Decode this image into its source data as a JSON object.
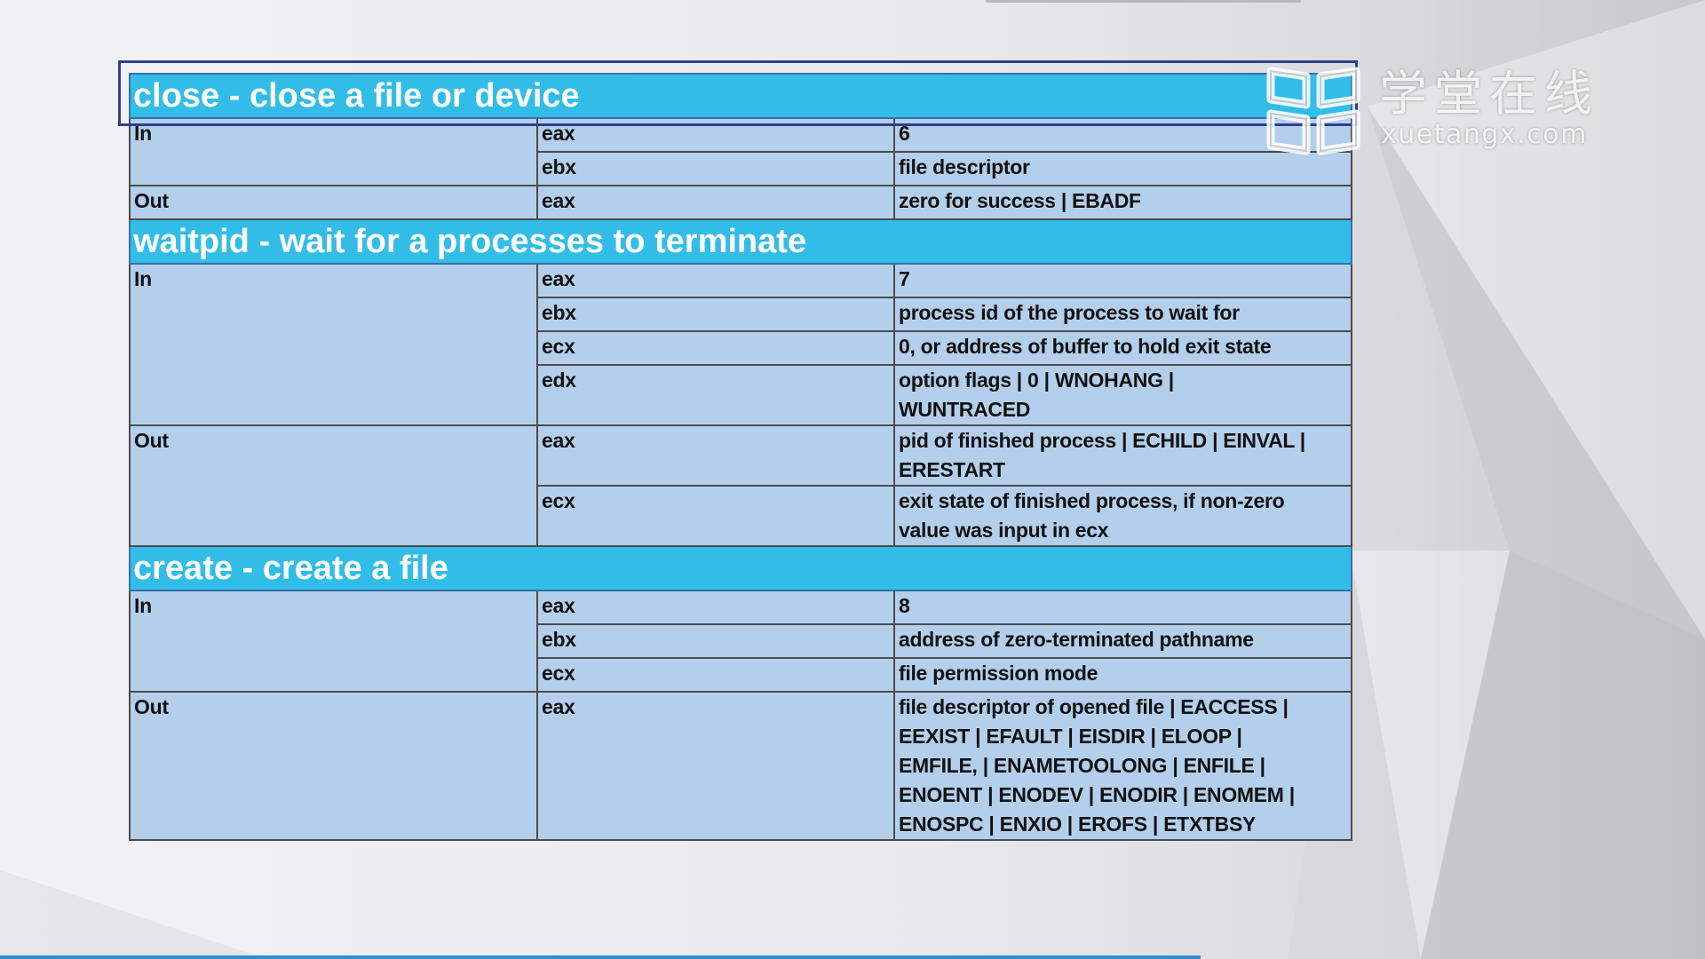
{
  "watermark": {
    "brand_cn": "学堂在线",
    "brand_url": "xuetangx.com"
  },
  "sections": [
    {
      "title": "close - close a file or device",
      "groups": [
        {
          "dir": "In",
          "rows": [
            {
              "reg": "eax",
              "value": [
                "6"
              ]
            },
            {
              "reg": "ebx",
              "value": [
                "file descriptor"
              ]
            }
          ]
        },
        {
          "dir": "Out",
          "rows": [
            {
              "reg": "eax",
              "value": [
                "zero for success | EBADF"
              ]
            }
          ]
        }
      ]
    },
    {
      "title": "waitpid - wait for a processes to terminate",
      "groups": [
        {
          "dir": "In",
          "rows": [
            {
              "reg": "eax",
              "value": [
                "7"
              ]
            },
            {
              "reg": "ebx",
              "value": [
                "process id of the process to wait for"
              ]
            },
            {
              "reg": "ecx",
              "value": [
                "0, or address of buffer to hold exit state"
              ]
            },
            {
              "reg": "edx",
              "value": [
                "option flags | 0 | WNOHANG |",
                "WUNTRACED"
              ]
            }
          ]
        },
        {
          "dir": "Out",
          "rows": [
            {
              "reg": "eax",
              "value": [
                "pid of finished process | ECHILD | EINVAL |",
                "ERESTART"
              ]
            },
            {
              "reg": "ecx",
              "value": [
                "exit state of finished process, if non-zero",
                "value was input in ecx"
              ]
            }
          ]
        }
      ]
    },
    {
      "title": "create - create a file",
      "groups": [
        {
          "dir": "In",
          "rows": [
            {
              "reg": "eax",
              "value": [
                "8"
              ]
            },
            {
              "reg": "ebx",
              "value": [
                "address of zero-terminated pathname"
              ]
            },
            {
              "reg": "ecx",
              "value": [
                "file permission mode"
              ]
            }
          ]
        },
        {
          "dir": "Out",
          "rows": [
            {
              "reg": "eax",
              "value": [
                "file descriptor of opened file | EACCESS |",
                "EEXIST  | EFAULT | EISDIR | ELOOP |",
                "EMFILE, | ENAMETOOLONG | ENFILE |",
                "ENOENT | ENODEV | ENODIR | ENOMEM |",
                "ENOSPC | ENXIO | EROFS | ETXTBSY"
              ]
            }
          ]
        }
      ]
    }
  ]
}
